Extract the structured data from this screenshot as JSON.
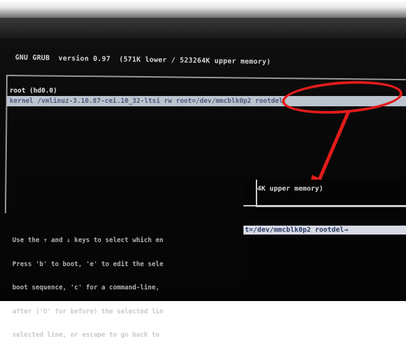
{
  "grub": {
    "title": "GNU GRUB  version 0.97  (571K lower / 523264K upper memory)",
    "entries": [
      "root (hd0.0)",
      "kernel /vmlinuz-3.10.87-cei.10_32-ltsi rw root=/dev/mmcblk0p2 rootdel"
    ],
    "help_lines": [
      "Use the ↑ and ↓ keys to select which en",
      "Press 'b' to boot, 'e' to edit the sele",
      "boot sequence, 'c' for a command-line,",
      "after ('O' for before) the selected lin",
      "selected line, or escape to go back to"
    ]
  },
  "zoom": {
    "title": "4K upper memory)",
    "line": "t=/dev/mmcblk0p2 rootdel→"
  },
  "annotation": {
    "color": "#e31b1b",
    "shapes": [
      "red-ellipse",
      "red-arrow"
    ]
  }
}
